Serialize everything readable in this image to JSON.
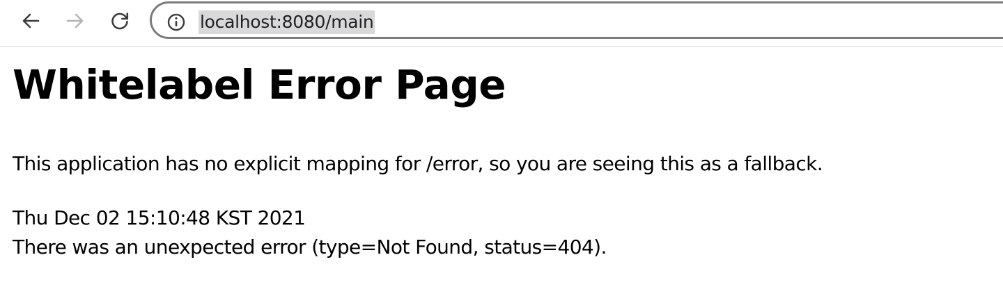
{
  "browser": {
    "url": "localhost:8080/main",
    "back_icon": "arrow-left-icon",
    "forward_icon": "arrow-right-icon",
    "reload_icon": "reload-icon",
    "site_info_icon": "info-circle-icon",
    "forward_enabled": false
  },
  "page": {
    "title": "Whitelabel Error Page",
    "message": "This application has no explicit mapping for /error, so you are seeing this as a fallback.",
    "timestamp": "Thu Dec 02 15:10:48 KST 2021",
    "error_detail": "There was an unexpected error (type=Not Found, status=404)."
  },
  "colors": {
    "icon_active": "#3c3c3c",
    "icon_disabled": "#b4b4b4",
    "omnibox_border": "#7b7b7b",
    "url_highlight": "#d9d9d9"
  }
}
